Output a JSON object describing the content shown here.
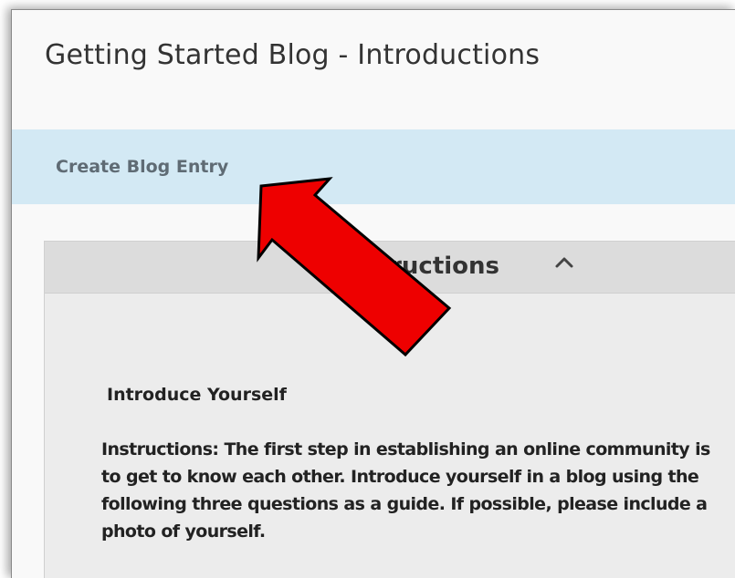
{
  "page": {
    "title": "Getting Started Blog - Introductions"
  },
  "action_bar": {
    "create_label": "Create Blog Entry"
  },
  "instructions": {
    "header_label": "Instructions",
    "heading": "Introduce Yourself",
    "body": "Instructions:  The first step in establishing an online community is to get to know each other. Introduce yourself in a blog using the following three questions as a guide. If possible, please include a photo of yourself."
  },
  "annotation": {
    "arrow_color": "#ee0000",
    "arrow_icon": "red-pointer-arrow-icon"
  },
  "colors": {
    "action_bar_bg": "#d3e9f4",
    "panel_bg": "#ececec",
    "panel_header_bg": "#dcdcdc"
  }
}
